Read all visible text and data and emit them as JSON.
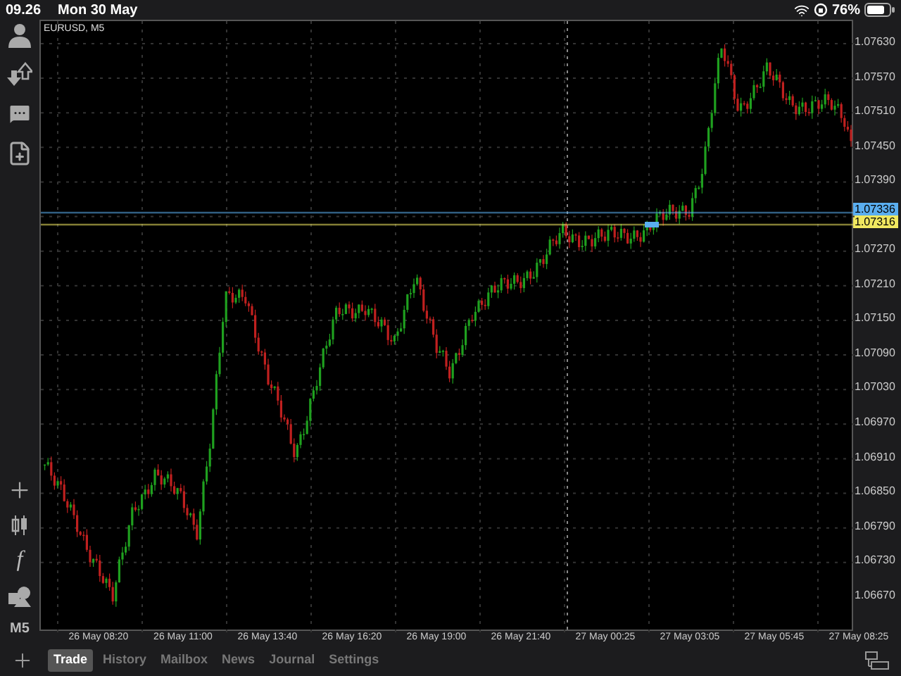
{
  "status_bar": {
    "time": "09.26",
    "date": "Mon 30 May",
    "battery": "76%"
  },
  "sidebar": {
    "function_label": "f",
    "timeframe": "M5"
  },
  "chart": {
    "symbol": "EURUSD, M5",
    "ticks_above": [
      "1.07630",
      "1.07570",
      "1.07510",
      "1.07450",
      "1.07390"
    ],
    "price_lines": [
      {
        "label": "1.07336",
        "color": "#5aaef0"
      },
      {
        "label": "1.07316",
        "color": "#f0e860"
      }
    ],
    "ticks_below": [
      "1.07270",
      "1.07210",
      "1.07150",
      "1.07090",
      "1.07030",
      "1.06970",
      "1.06910",
      "1.06850",
      "1.06790",
      "1.06730",
      "1.06670"
    ],
    "time_labels": [
      "26 May 08:20",
      "26 May 11:00",
      "26 May 13:40",
      "26 May 16:20",
      "26 May 19:00",
      "26 May 21:40",
      "27 May 00:25",
      "27 May 03:05",
      "27 May 05:45",
      "27 May 08:25"
    ]
  },
  "tabs": [
    {
      "label": "Trade",
      "selected": true
    },
    {
      "label": "History",
      "selected": false
    },
    {
      "label": "Mailbox",
      "selected": false
    },
    {
      "label": "News",
      "selected": false
    },
    {
      "label": "Journal",
      "selected": false
    },
    {
      "label": "Settings",
      "selected": false
    }
  ]
}
